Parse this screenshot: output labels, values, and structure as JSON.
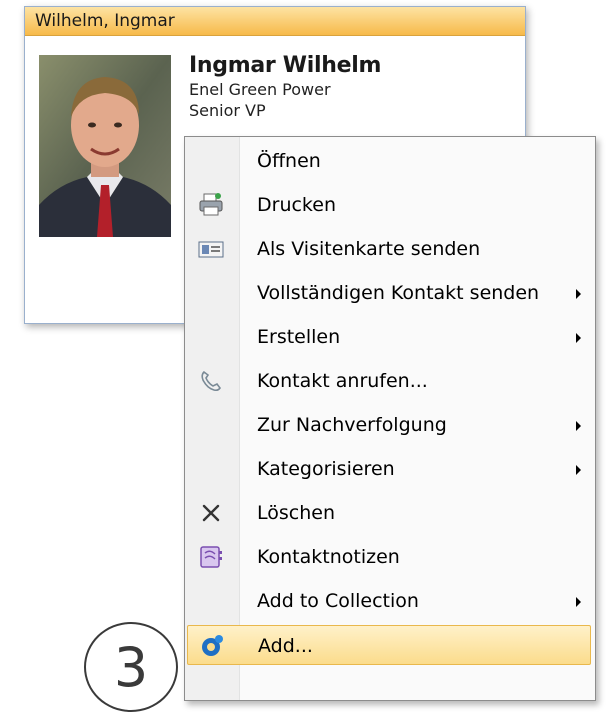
{
  "card": {
    "header_title": "Wilhelm, Ingmar",
    "name": "Ingmar Wilhelm",
    "company": "Enel Green Power",
    "job_title": "Senior VP"
  },
  "context_menu": {
    "items": [
      {
        "label": "Öffnen",
        "icon": "",
        "has_submenu": false
      },
      {
        "label": "Drucken",
        "icon": "printer-icon",
        "has_submenu": false
      },
      {
        "label": "Als Visitenkarte senden",
        "icon": "business-card-icon",
        "has_submenu": false
      },
      {
        "label": "Vollständigen Kontakt senden",
        "icon": "",
        "has_submenu": true
      },
      {
        "label": "Erstellen",
        "icon": "",
        "has_submenu": true
      },
      {
        "label": "Kontakt anrufen...",
        "icon": "phone-icon",
        "has_submenu": false
      },
      {
        "label": "Zur Nachverfolgung",
        "icon": "",
        "has_submenu": true
      },
      {
        "label": "Kategorisieren",
        "icon": "",
        "has_submenu": true
      },
      {
        "label": "Löschen",
        "icon": "delete-icon",
        "has_submenu": false
      },
      {
        "label": "Kontaktnotizen",
        "icon": "contact-notes-icon",
        "has_submenu": false
      },
      {
        "label": "Add to Collection",
        "icon": "",
        "has_submenu": true
      },
      {
        "label": "Add...",
        "icon": "outlook-add-icon",
        "has_submenu": false,
        "highlighted": true
      }
    ]
  },
  "step_marker": "3",
  "colors": {
    "header_gradient_top": "#fde3a3",
    "header_gradient_bottom": "#f7ba4a",
    "highlight_border": "#e9b84c",
    "card_border": "#9ab0cd"
  }
}
